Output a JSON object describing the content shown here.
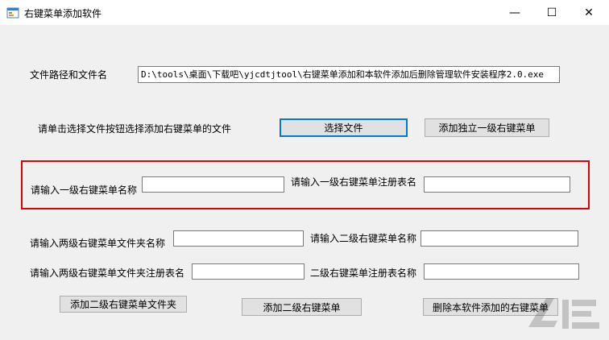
{
  "window": {
    "title": "右键菜单添加软件",
    "controls": {
      "minimize": "—",
      "maximize": "☐",
      "close": "✕"
    }
  },
  "path_row": {
    "label": "文件路径和文件名",
    "value": "D:\\tools\\桌面\\下载吧\\yjcdtjtool\\右键菜单添加和本软件添加后删除管理软件安装程序2.0.exe"
  },
  "select_row": {
    "prompt": "请单击选择文件按钮选择添加右键菜单的文件",
    "select_button": "选择文件",
    "add_standalone_button": "添加独立一级右键菜单"
  },
  "level1": {
    "name_label": "请输入一级右键菜单名称",
    "name_value": "",
    "reg_label": "请输入一级右键菜单注册表名",
    "reg_value": ""
  },
  "level2": {
    "folder_name_label": "请输入两级右键菜单文件夹名称",
    "folder_name_value": "",
    "sub_name_label": "请输入二级右键菜单名称",
    "sub_name_value": "",
    "folder_reg_label": "请输入两级右键菜单文件夹注册表名",
    "folder_reg_value": "",
    "sub_reg_label": "二级右键菜单注册表名称",
    "sub_reg_value": ""
  },
  "buttons": {
    "add_folder": "添加二级右键菜单文件夹",
    "add_sub": "添加二级右键菜单",
    "delete_added": "删除本软件添加的右键菜单"
  },
  "icons": {
    "app": "app-window-icon",
    "minimize": "minimize-icon",
    "maximize": "maximize-icon",
    "close": "close-icon",
    "watermark": "watermark-logo"
  }
}
